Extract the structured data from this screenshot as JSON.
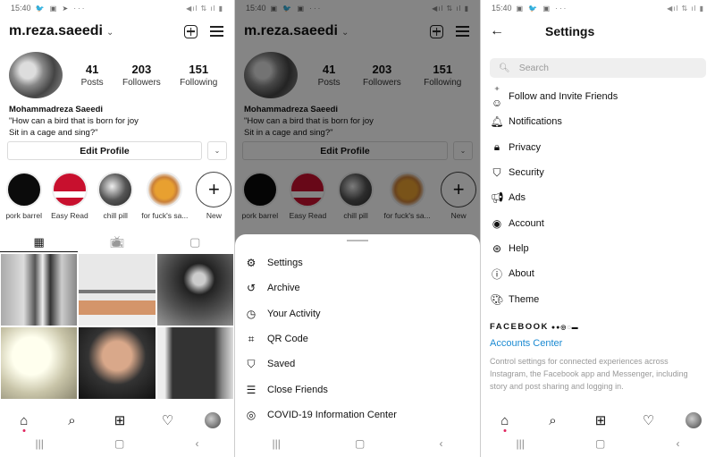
{
  "status_bar": {
    "time": "15:40",
    "right_icons": "◀ıl ⇅ ıl ▮"
  },
  "profile": {
    "username": "m.reza.saeedi",
    "stats": [
      {
        "value": "41",
        "label": "Posts"
      },
      {
        "value": "203",
        "label": "Followers"
      },
      {
        "value": "151",
        "label": "Following"
      }
    ],
    "name": "Mohammadreza Saeedi",
    "bio_line1": "\"How can a bird that is born for joy",
    "bio_line2": "Sit in a cage and sing?\"",
    "edit_profile_label": "Edit Profile",
    "highlights": [
      {
        "label": "pork barrel"
      },
      {
        "label": "Easy Read"
      },
      {
        "label": "chill pill"
      },
      {
        "label": "for fuck's sa..."
      },
      {
        "label": "New"
      }
    ],
    "tabs": [
      "grid",
      "igtv",
      "tagged"
    ]
  },
  "menu_sheet": {
    "items": [
      {
        "label": "Settings",
        "icon": "gear-icon"
      },
      {
        "label": "Archive",
        "icon": "archive-icon"
      },
      {
        "label": "Your Activity",
        "icon": "activity-icon"
      },
      {
        "label": "QR Code",
        "icon": "qr-code-icon"
      },
      {
        "label": "Saved",
        "icon": "bookmark-icon"
      },
      {
        "label": "Close Friends",
        "icon": "list-icon"
      },
      {
        "label": "COVID-19 Information Center",
        "icon": "covid-info-icon"
      }
    ]
  },
  "settings": {
    "title": "Settings",
    "search_placeholder": "Search",
    "items": [
      {
        "label": "Follow and Invite Friends",
        "icon": "add-person-icon"
      },
      {
        "label": "Notifications",
        "icon": "bell-icon"
      },
      {
        "label": "Privacy",
        "icon": "lock-icon"
      },
      {
        "label": "Security",
        "icon": "shield-icon"
      },
      {
        "label": "Ads",
        "icon": "megaphone-icon"
      },
      {
        "label": "Account",
        "icon": "account-icon"
      },
      {
        "label": "Help",
        "icon": "lifebuoy-icon"
      },
      {
        "label": "About",
        "icon": "info-icon"
      },
      {
        "label": "Theme",
        "icon": "palette-icon"
      }
    ],
    "facebook_header": "FACEBOOK",
    "accounts_center": "Accounts Center",
    "accounts_center_desc": "Control settings for connected experiences across Instagram, the Facebook app and Messenger, including story and post sharing and logging in.",
    "accent_color": "#1b8ad2"
  }
}
